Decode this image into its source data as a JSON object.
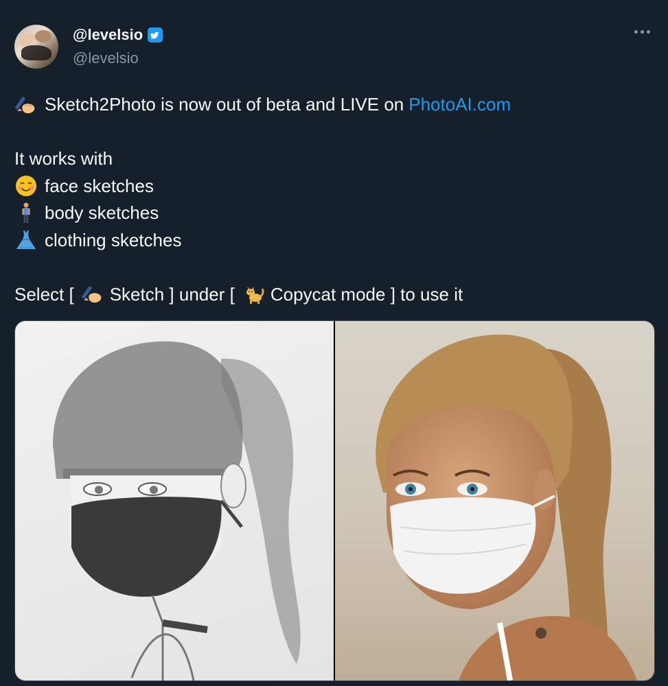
{
  "author": {
    "display_name": "@levelsio",
    "handle": "@levelsio"
  },
  "tweet": {
    "line1_text": "Sketch2Photo is now out of beta and LIVE on",
    "line1_link": "PhotoAI.com",
    "line2": "It works with",
    "list": [
      "face sketches",
      "body sketches",
      "clothing sketches"
    ],
    "select_part1": "Select [",
    "select_part2": "Sketch ] under [",
    "select_part3": "Copycat mode ] to use it"
  },
  "icons": {
    "verified": "verified-badge-icon",
    "more": "more-options-icon",
    "line1": "writing-hand-icon",
    "face": "smiling-face-icon",
    "body": "person-standing-icon",
    "clothing": "dress-icon",
    "sketch": "writing-hand-icon",
    "copycat": "cat-icon"
  },
  "colors": {
    "background": "#15202b",
    "text": "#f7f9f9",
    "muted": "#8b98a5",
    "link": "#1d9bf0",
    "verified": "#1d9bf0"
  }
}
